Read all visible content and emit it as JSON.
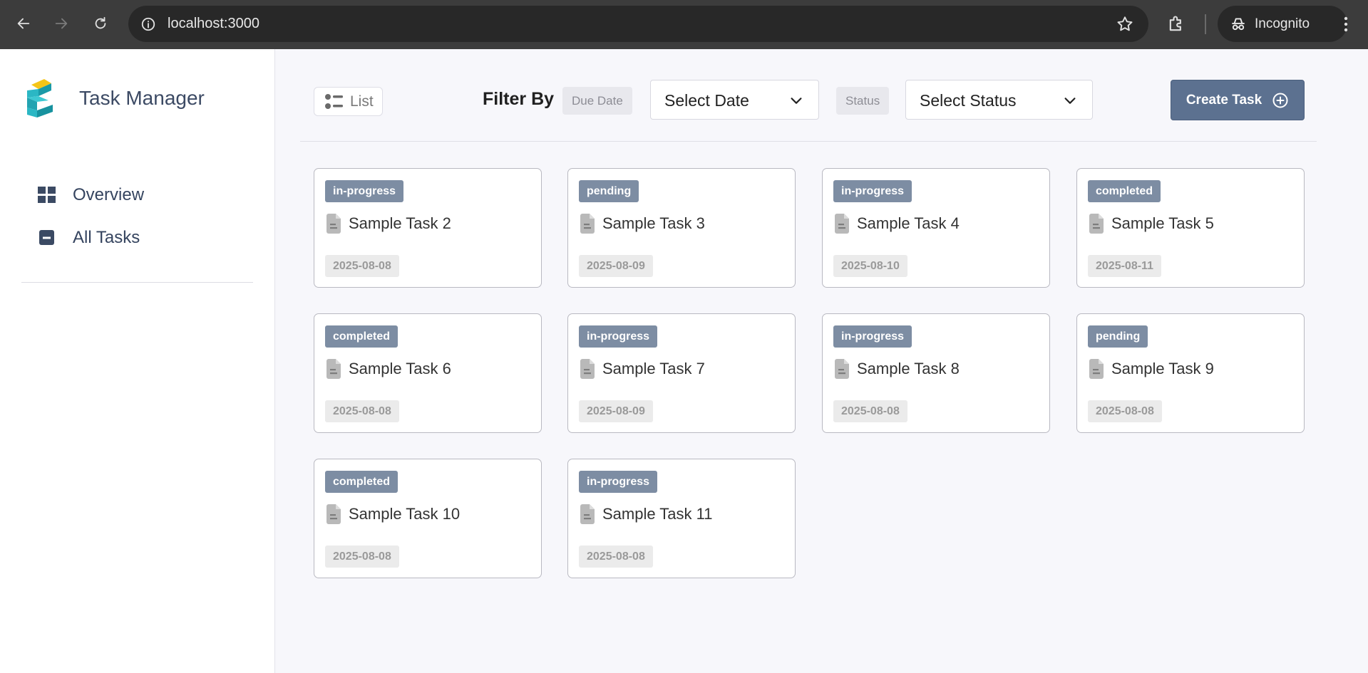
{
  "browser": {
    "url": "localhost:3000",
    "profile_label": "Incognito"
  },
  "sidebar": {
    "brand": "Task Manager",
    "items": [
      {
        "label": "Overview",
        "icon": "grid-icon"
      },
      {
        "label": "All Tasks",
        "icon": "minus-square-icon"
      }
    ]
  },
  "toolbar": {
    "view_label": "List",
    "filter_by_label": "Filter By",
    "due_date_label": "Due Date",
    "date_select_value": "Select Date",
    "status_label": "Status",
    "status_select_value": "Select Status",
    "create_label": "Create Task"
  },
  "colors": {
    "status_badge": "#7d8da3",
    "create_button": "#5c7190",
    "brand_text": "#3c4a64"
  },
  "tasks": [
    {
      "status": "in-progress",
      "title": "Sample Task 2",
      "date": "2025-08-08"
    },
    {
      "status": "pending",
      "title": "Sample Task 3",
      "date": "2025-08-09"
    },
    {
      "status": "in-progress",
      "title": "Sample Task 4",
      "date": "2025-08-10"
    },
    {
      "status": "completed",
      "title": "Sample Task 5",
      "date": "2025-08-11"
    },
    {
      "status": "completed",
      "title": "Sample Task 6",
      "date": "2025-08-08"
    },
    {
      "status": "in-progress",
      "title": "Sample Task 7",
      "date": "2025-08-09"
    },
    {
      "status": "in-progress",
      "title": "Sample Task 8",
      "date": "2025-08-08"
    },
    {
      "status": "pending",
      "title": "Sample Task 9",
      "date": "2025-08-08"
    },
    {
      "status": "completed",
      "title": "Sample Task 10",
      "date": "2025-08-08"
    },
    {
      "status": "in-progress",
      "title": "Sample Task 11",
      "date": "2025-08-08"
    }
  ]
}
